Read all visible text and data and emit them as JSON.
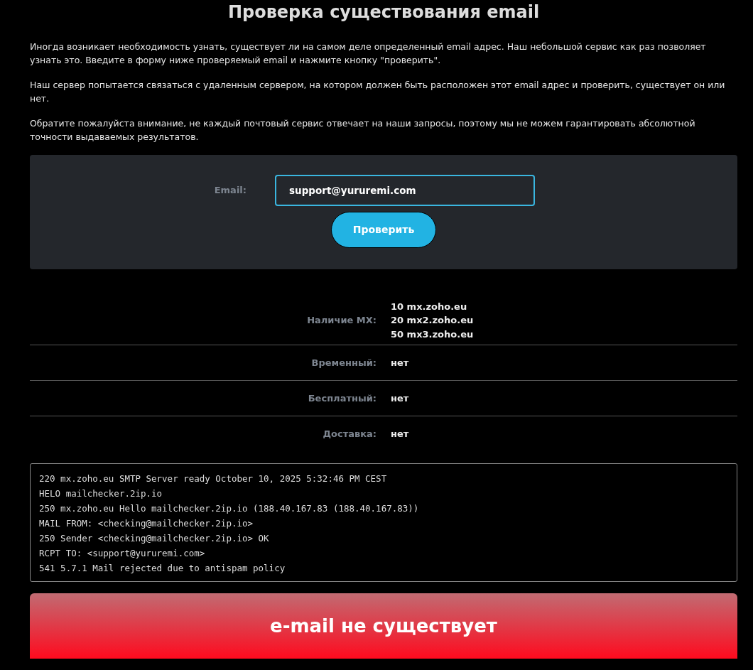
{
  "title": "Проверка существования email",
  "paragraphs": [
    "Иногда возникает необходимость узнать, существует ли на самом деле определенный email адрес. Наш небольшой сервис как раз позволяет узнать это. Введите в форму ниже проверяемый email и нажмите кнопку \"проверить\".",
    "Наш сервер попытается связаться с удаленным сервером, на котором должен быть расположен этот email адрес и проверить, существует он или нет.",
    "Обратите пожалуйста внимание, не каждый почтовый сервис отвечает на наши запросы, поэтому мы не можем гарантировать абсолютной точности выдаваемых результатов."
  ],
  "form": {
    "label": "Email:",
    "value": "support@yururemi.com",
    "button": "Проверить"
  },
  "results": [
    {
      "label": "Наличие MX:",
      "values": [
        "10 mx.zoho.eu",
        "20 mx2.zoho.eu",
        "50 mx3.zoho.eu"
      ]
    },
    {
      "label": "Временный:",
      "values": [
        "нет"
      ]
    },
    {
      "label": "Бесплатный:",
      "values": [
        "нет"
      ]
    },
    {
      "label": "Доставка:",
      "values": [
        "нет"
      ]
    }
  ],
  "log": [
    "220 mx.zoho.eu SMTP Server ready October 10, 2025 5:32:46 PM CEST",
    "HELO mailchecker.2ip.io",
    "250 mx.zoho.eu Hello mailchecker.2ip.io (188.40.167.83 (188.40.167.83))",
    "MAIL FROM: <checking@mailchecker.2ip.io>",
    "250 Sender <checking@mailchecker.2ip.io> OK",
    "RCPT TO: <support@yururemi.com>",
    "541 5.7.1 Mail rejected due to antispam policy"
  ],
  "verdict": {
    "text": "e-mail не существует",
    "exists": false
  }
}
